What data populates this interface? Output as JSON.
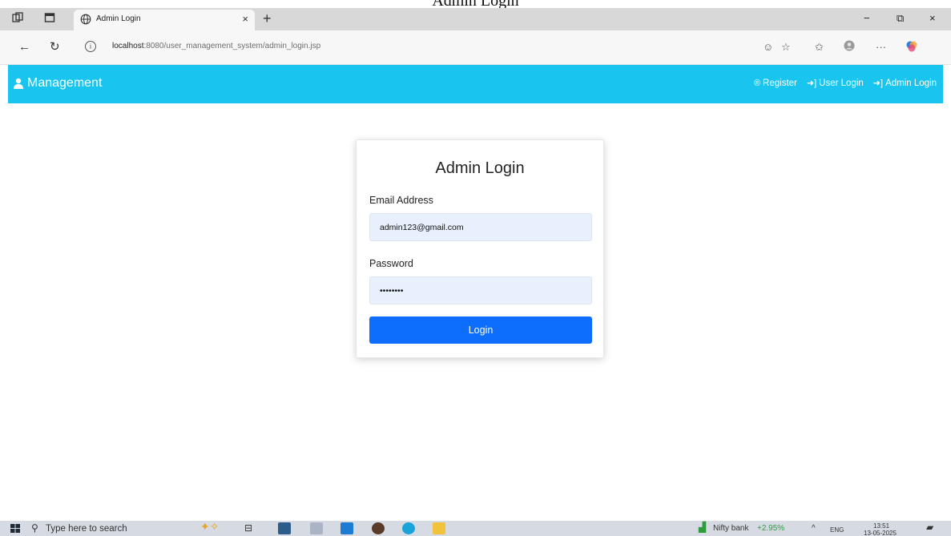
{
  "caption": "Admin Login",
  "browser": {
    "tab_title": "Admin Login",
    "tab_close": "×",
    "new_tab": "+",
    "url_host": "localhost",
    "url_path": ":8080/user_management_system/admin_login.jsp",
    "window_controls": {
      "minimize": "−",
      "restore": "⧉",
      "close": "×"
    },
    "more_menu": "···"
  },
  "app": {
    "brand": "Management",
    "nav": {
      "register": "Register",
      "user_login": "User Login",
      "admin_login": "Admin Login"
    },
    "accent_color": "#19c5ee"
  },
  "form": {
    "title": "Admin Login",
    "email_label": "Email Address",
    "email_value": "admin123@gmail.com",
    "password_label": "Password",
    "password_value": "••••••••",
    "submit_label": "Login",
    "button_color": "#0d6efd"
  },
  "taskbar": {
    "search_placeholder": "Type here to search",
    "nifty_label": "Nifty bank",
    "nifty_change": "+2.95%",
    "lang": "ENG",
    "time": "13:51",
    "date": "13-05-2025"
  }
}
